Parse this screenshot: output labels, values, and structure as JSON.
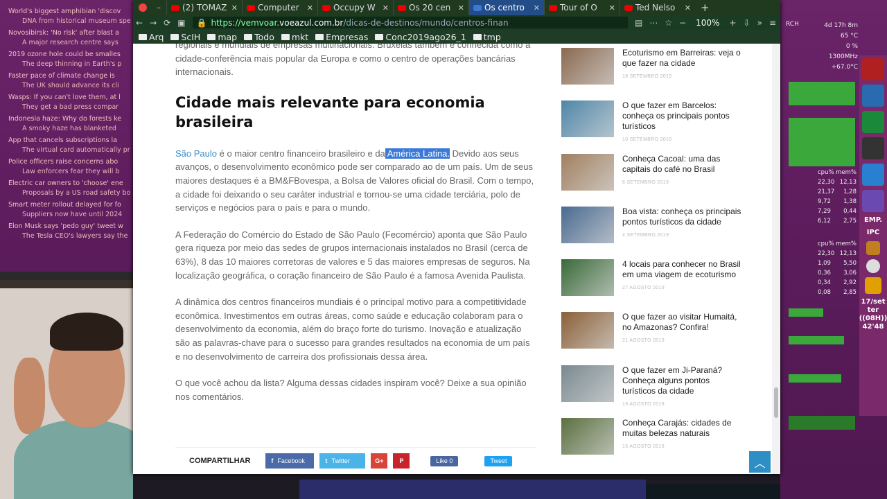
{
  "news": [
    {
      "headline": "World's biggest amphibian 'discov",
      "sub": "DNA from historical museum spe"
    },
    {
      "headline": "Novosibirsk: 'No risk' after blast a",
      "sub": "A major research centre says"
    },
    {
      "headline": "2019 ozone hole could be smalles",
      "sub": "The deep thinning in Earth's p"
    },
    {
      "headline": "Faster pace of climate change is",
      "sub": "The UK should advance its cli"
    },
    {
      "headline": "Wasps: If you can't love them, at l",
      "sub": "They get a bad press compar"
    },
    {
      "headline": "Indonesia haze: Why do forests ke",
      "sub": "A smoky haze has blanketed"
    },
    {
      "headline": "App that cancels subscriptions la",
      "sub": "The virtual card automatically pr"
    },
    {
      "headline": "Police officers raise concerns abo",
      "sub": "Law enforcers fear they will b"
    },
    {
      "headline": "Electric car owners to 'choose' ene",
      "sub": "Proposals by a US road safety bo"
    },
    {
      "headline": "Smart meter rollout delayed for fo",
      "sub": "Suppliers now have until 2024"
    },
    {
      "headline": "Elon Musk says 'pedo guy' tweet w",
      "sub": "The Tesla CEO's lawyers say the"
    }
  ],
  "browser": {
    "tabs": [
      {
        "label": "(2) TOMAZ",
        "icon": "youtube-icon",
        "active": false
      },
      {
        "label": "Computer",
        "icon": "youtube-icon",
        "active": false
      },
      {
        "label": "Occupy W",
        "icon": "youtube-icon",
        "active": false
      },
      {
        "label": "Os 20 cen",
        "icon": "youtube-icon",
        "active": false
      },
      {
        "label": "Os centro",
        "icon": "page-icon",
        "active": true
      },
      {
        "label": "Tour of O",
        "icon": "youtube-icon",
        "active": false
      },
      {
        "label": "Ted Nelso",
        "icon": "youtube-icon",
        "active": false
      }
    ],
    "url_prefix": "https://vemvoar.",
    "url_host": "voeazul.com.br",
    "url_path": "/dicas-de-destinos/mundo/centros-finan",
    "zoom": "100%",
    "bookmarks": [
      "Arq",
      "ScIH",
      "map",
      "Todo",
      "mkt",
      "Empresas",
      "Conc2019ago26_1",
      "tmp"
    ]
  },
  "article": {
    "intro_lines": "regionais e mundiais de empresas multinacionais. Bruxelas também é conhecida como a cidade-conferência mais popular da Europa e como o centro de operações bancárias internacionais.",
    "heading": "Cidade mais relevante para economia brasileira",
    "p1_link": "São Paulo",
    "p1_a": " é o maior centro financeiro brasileiro e da",
    "p1_highlight": " América Latina.",
    "p1_b": " Devido aos seus avanços, o desenvolvimento econômico pode ser comparado ao de um país. Um de seus maiores destaques é a BM&FBovespa, a Bolsa de Valores oficial do Brasil. Com o tempo, a cidade foi deixando o seu caráter industrial e tornou-se uma cidade terciária, polo de serviços e negócios para o país e para o mundo.",
    "p2": "A Federação do Comércio do Estado de São Paulo (Fecomércio) aponta que São Paulo gera riqueza por meio das sedes de grupos internacionais instalados no Brasil (cerca de 63%), 8 das 10 maiores corretoras de valores e 5 das maiores empresas de seguros. Na localização geográfica, o coração financeiro de São Paulo é a famosa Avenida Paulista.",
    "p3": "A dinâmica dos centros financeiros mundiais é o principal motivo para a competitividade econômica. Investimentos em outras áreas, como saúde e educação colaboram para o desenvolvimento da economia, além do braço forte do turismo. Inovação e atualização são as palavras-chave para o sucesso para grandes resultados na economia de um país e no desenvolvimento de carreira dos profissionais dessa área.",
    "p4": "O que você achou da lista? Alguma dessas cidades inspiram você? Deixe a sua opinião nos comentários.",
    "share_label": "COMPARTILHAR",
    "facebook": "Facebook",
    "twitter": "Twitter",
    "like": "Like 0",
    "tweet": "Tweet"
  },
  "sidebar": [
    {
      "title": "Ecoturismo em Barreiras: veja o que fazer na cidade",
      "date": "18 SETEMBRO 2019",
      "color": "#8a6a50"
    },
    {
      "title": "O que fazer em Barcelos: conheça os principais pontos turísticos",
      "date": "10 SETEMBRO 2019",
      "color": "#4f86a8"
    },
    {
      "title": "Conheça Cacoal: uma das capitais do café no Brasil",
      "date": "6 SETEMBRO 2019",
      "color": "#a08060"
    },
    {
      "title": "Boa vista: conheça os principais pontos turísticos da cidade",
      "date": "4 SETEMBRO 2019",
      "color": "#4a6a90"
    },
    {
      "title": "4 locais para conhecer no Brasil em uma viagem de ecoturismo",
      "date": "27 AGOSTO 2019",
      "color": "#3a6a3a"
    },
    {
      "title": "O que fazer ao visitar Humaitá, no Amazonas? Confira!",
      "date": "21 AGOSTO 2019",
      "color": "#8a6038"
    },
    {
      "title": "O que fazer em Ji-Paraná? Conheça alguns pontos turísticos da cidade",
      "date": "19 AGOSTO 2019",
      "color": "#7a8a90"
    },
    {
      "title": "Conheça Carajás: cidades de muitas belezas naturais",
      "date": "15 AGOSTO 2019",
      "color": "#5a7040"
    }
  ],
  "system": {
    "uptime": "4d 17h 8m",
    "temp1": "65 °C",
    "load": "0 %",
    "freq": "1300MHz",
    "temp2": "+67.0°C",
    "arch": "RCH",
    "proc_header_cpu": "cpu%",
    "proc_header_mem": "mem%",
    "procs1": [
      [
        "22,30",
        "12,13"
      ],
      [
        "21,37",
        "1,28"
      ],
      [
        "9,72",
        "1,38"
      ],
      [
        "7,29",
        "0,44"
      ],
      [
        "6,12",
        "2,75"
      ]
    ],
    "procs2": [
      [
        "22,30",
        "12,13"
      ],
      [
        "1,09",
        "5,50"
      ],
      [
        "0,36",
        "3,06"
      ],
      [
        "0,34",
        "2,92"
      ],
      [
        "0,08",
        "2,85"
      ]
    ],
    "dock_emp": "EMP.",
    "dock_ipc": "IPC",
    "dock_date": "17/set",
    "dock_day": "ter",
    "dock_time": "((08H))",
    "dock_min": "42'48"
  }
}
